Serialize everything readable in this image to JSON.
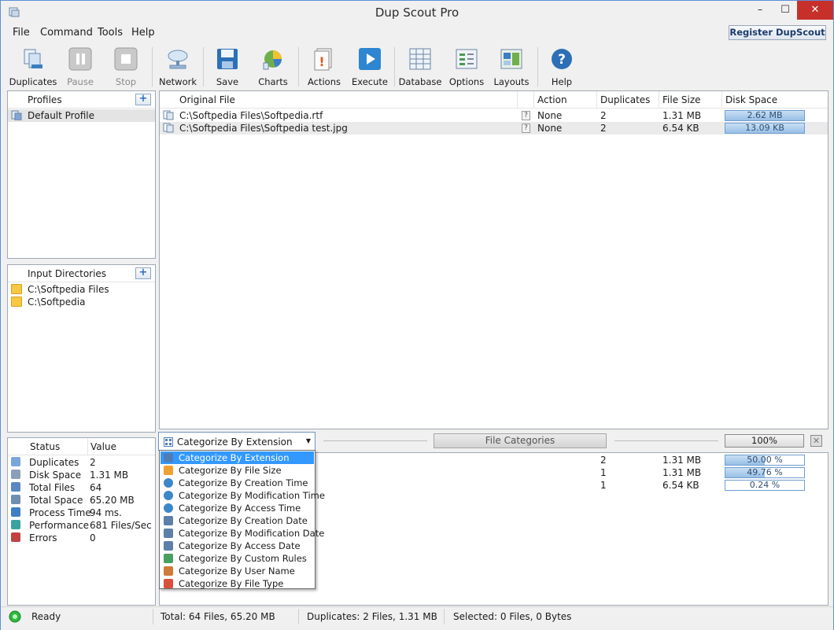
{
  "window": {
    "title": "Dup Scout Pro",
    "minimize": "–",
    "maximize": "☐",
    "close": "✕"
  },
  "menu": {
    "items": [
      "File",
      "Command",
      "Tools",
      "Help"
    ],
    "register_label": "Register DupScout"
  },
  "toolbar": {
    "duplicates": "Duplicates",
    "pause": "Pause",
    "stop": "Stop",
    "network": "Network",
    "save": "Save",
    "charts": "Charts",
    "actions": "Actions",
    "execute": "Execute",
    "database": "Database",
    "options": "Options",
    "layouts": "Layouts",
    "help": "Help"
  },
  "profiles": {
    "header": "Profiles",
    "add": "+",
    "items": [
      "Default Profile"
    ]
  },
  "input_dirs": {
    "header": "Input Directories",
    "add": "+",
    "items": [
      "C:\\Softpedia Files",
      "C:\\Softpedia"
    ]
  },
  "status_panel": {
    "col_status": "Status",
    "col_value": "Value",
    "rows": [
      {
        "label": "Duplicates",
        "value": "2",
        "icon": "duplicates-icon",
        "color": "#7aa7d9"
      },
      {
        "label": "Disk Space",
        "value": "1.31 MB",
        "icon": "disk-icon",
        "color": "#8aa0b8"
      },
      {
        "label": "Total Files",
        "value": "64",
        "icon": "files-icon",
        "color": "#5a86c2"
      },
      {
        "label": "Total Space",
        "value": "65.20 MB",
        "icon": "drive-icon",
        "color": "#6f8fb0"
      },
      {
        "label": "Process Time",
        "value": "94 ms.",
        "icon": "clock-icon",
        "color": "#3f7fc4"
      },
      {
        "label": "Performance",
        "value": "681 Files/Sec",
        "icon": "performance-icon",
        "color": "#3aa3a0"
      },
      {
        "label": "Errors",
        "value": "0",
        "icon": "error-icon",
        "color": "#c24242"
      }
    ]
  },
  "results": {
    "columns": {
      "original": "Original File",
      "action": "Action",
      "duplicates": "Duplicates",
      "size": "File Size",
      "space": "Disk Space"
    },
    "rows": [
      {
        "file": "C:\\Softpedia Files\\Softpedia.rtf",
        "action": "None",
        "duplicates": "2",
        "size": "1.31 MB",
        "space": "2.62 MB",
        "fill": 1.0
      },
      {
        "file": "C:\\Softpedia Files\\Softpedia test.jpg",
        "action": "None",
        "duplicates": "2",
        "size": "6.54 KB",
        "space": "13.09 KB",
        "fill": 1.0
      }
    ]
  },
  "categories": {
    "selected": "Categorize By Extension",
    "file_categories_label": "File Categories",
    "percent": "100%",
    "close": "✕",
    "rows": [
      {
        "count": "2",
        "size": "1.31 MB",
        "pct": "50.00 %",
        "fill": 0.5
      },
      {
        "count": "1",
        "size": "1.31 MB",
        "pct": "49.76 %",
        "fill": 0.4976
      },
      {
        "count": "1",
        "size": "6.54 KB",
        "pct": "0.24 %",
        "fill": 0.0024
      }
    ],
    "options": [
      {
        "label": "Categorize By Extension",
        "icon": "grid-icon",
        "color": "#4f7db8"
      },
      {
        "label": "Categorize By File Size",
        "icon": "box-icon",
        "color": "#f0a030"
      },
      {
        "label": "Categorize By Creation Time",
        "icon": "clock-icon",
        "color": "#3d86c8"
      },
      {
        "label": "Categorize By Modification Time",
        "icon": "clock-icon",
        "color": "#3d86c8"
      },
      {
        "label": "Categorize By Access Time",
        "icon": "clock-icon",
        "color": "#3d86c8"
      },
      {
        "label": "Categorize By Creation Date",
        "icon": "calendar-icon",
        "color": "#5d7fa8"
      },
      {
        "label": "Categorize By Modification Date",
        "icon": "calendar-icon",
        "color": "#5d7fa8"
      },
      {
        "label": "Categorize By Access Date",
        "icon": "calendar-icon",
        "color": "#5d7fa8"
      },
      {
        "label": "Categorize By Custom Rules",
        "icon": "rules-icon",
        "color": "#48a060"
      },
      {
        "label": "Categorize By User Name",
        "icon": "users-icon",
        "color": "#d07a3a"
      },
      {
        "label": "Categorize By File Type",
        "icon": "filetype-icon",
        "color": "#d9503a"
      }
    ]
  },
  "statusbar": {
    "state": "Ready",
    "total": "Total: 64 Files, 65.20 MB",
    "duplicates": "Duplicates: 2 Files, 1.31 MB",
    "selected": "Selected: 0 Files, 0 Bytes"
  },
  "colors": {
    "accent": "#3399ff",
    "bar_fill": "#97bfe6",
    "ready": "#2dbb3a"
  }
}
